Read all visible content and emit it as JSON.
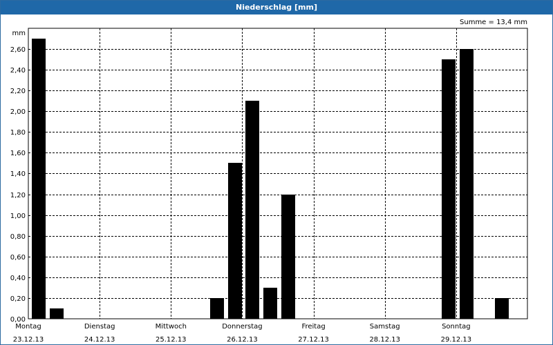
{
  "window": {
    "title": "Niederschlag [mm]"
  },
  "summary": "Summe = 13,4 mm",
  "chart_data": {
    "type": "bar",
    "title": "Niederschlag [mm]",
    "ylabel": "mm",
    "ylim": [
      0,
      2.8
    ],
    "yticks": [
      "0,00",
      "0,20",
      "0,40",
      "0,60",
      "0,80",
      "1,00",
      "1,20",
      "1,40",
      "1,60",
      "1,80",
      "2,00",
      "2,20",
      "2,40",
      "2,60"
    ],
    "grid": true,
    "days": [
      {
        "weekday": "Montag",
        "date": "23.12.13"
      },
      {
        "weekday": "Dienstag",
        "date": "24.12.13"
      },
      {
        "weekday": "Mittwoch",
        "date": "25.12.13"
      },
      {
        "weekday": "Donnerstag",
        "date": "26.12.13"
      },
      {
        "weekday": "Freitag",
        "date": "27.12.13"
      },
      {
        "weekday": "Samstag",
        "date": "28.12.13"
      },
      {
        "weekday": "Sonntag",
        "date": "29.12.13"
      }
    ],
    "bars": [
      {
        "day": 0,
        "slot": 0,
        "value": 2.7
      },
      {
        "day": 0,
        "slot": 1,
        "value": 0.1
      },
      {
        "day": 2,
        "slot": 2,
        "value": 0.2
      },
      {
        "day": 2,
        "slot": 3,
        "value": 1.5
      },
      {
        "day": 3,
        "slot": 0,
        "value": 2.1
      },
      {
        "day": 3,
        "slot": 1,
        "value": 0.3
      },
      {
        "day": 3,
        "slot": 2,
        "value": 1.2
      },
      {
        "day": 5,
        "slot": 3,
        "value": 2.5
      },
      {
        "day": 6,
        "slot": 0,
        "value": 2.6
      },
      {
        "day": 6,
        "slot": 2,
        "value": 0.2
      }
    ],
    "colors": {
      "bar": "#000000",
      "grid": "#000000"
    }
  }
}
